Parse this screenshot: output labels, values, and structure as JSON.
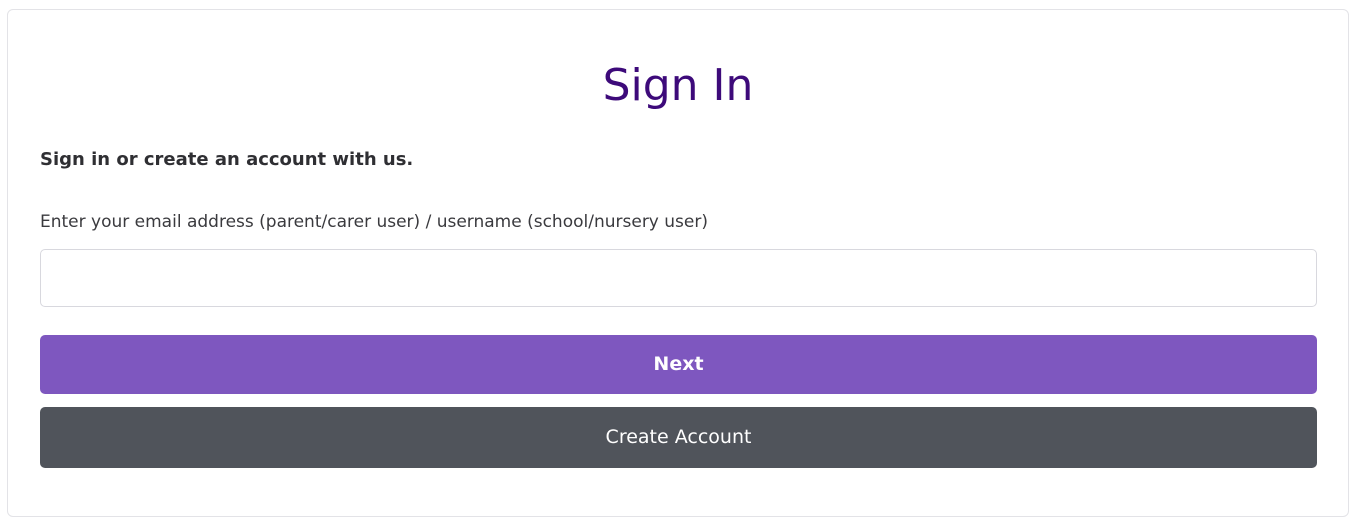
{
  "form": {
    "title": "Sign In",
    "subtitle": "Sign in or create an account with us.",
    "email_label": "Enter your email address (parent/carer user) / username (school/nursery user)",
    "email_value": "",
    "next_label": "Next",
    "create_account_label": "Create Account"
  },
  "colors": {
    "title": "#3d0a7a",
    "primary_button": "#7e57bf",
    "secondary_button": "#50545b"
  }
}
